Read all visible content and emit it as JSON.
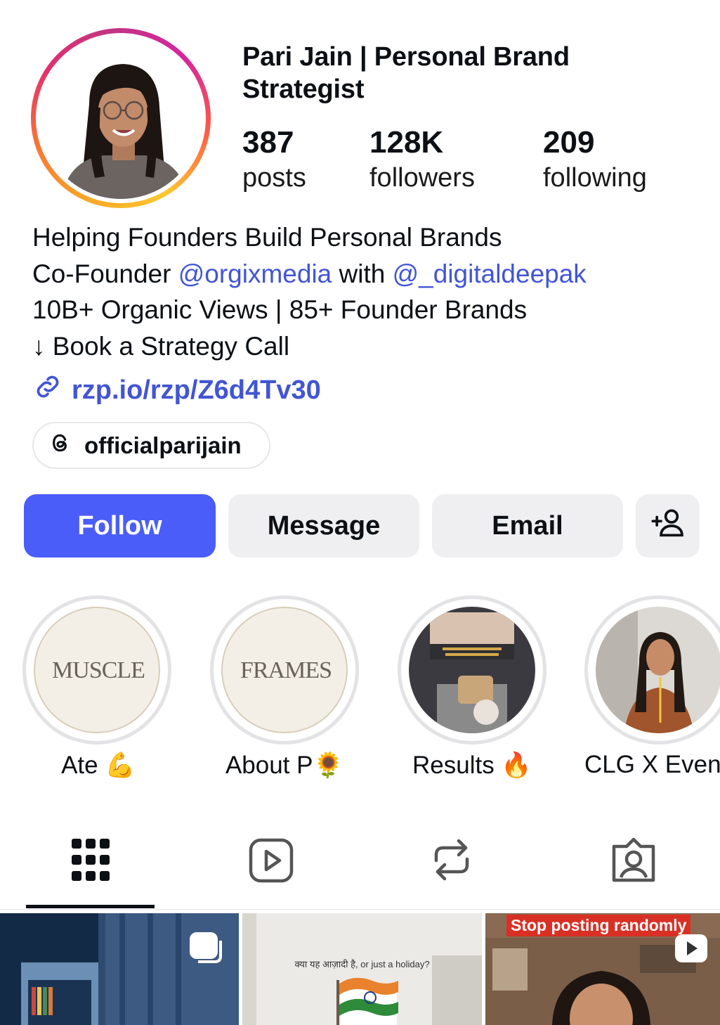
{
  "profile": {
    "name": "Pari Jain | Personal Brand Strategist",
    "stats": [
      {
        "value": "387",
        "label": "posts"
      },
      {
        "value": "128K",
        "label": "followers"
      },
      {
        "value": "209",
        "label": "following"
      }
    ],
    "bio": {
      "line1": "Helping Founders Build Personal Brands",
      "line2_prefix": "Co-Founder ",
      "mention1": "@orgixmedia",
      "line2_mid": " with ",
      "mention2": "@_digitaldeepak",
      "line3": "10B+ Organic Views | 85+ Founder Brands",
      "line4": "↓ Book a Strategy Call"
    },
    "link": "rzp.io/rzp/Z6d4Tv30",
    "threads_handle": "officialparijain"
  },
  "actions": {
    "follow": "Follow",
    "message": "Message",
    "email": "Email"
  },
  "highlights": [
    {
      "label": "Ate 💪",
      "cover_text": "MUSCLE"
    },
    {
      "label": "About P🌻",
      "cover_text": "FRAMES"
    },
    {
      "label": "Results 🔥",
      "cover_text": ""
    },
    {
      "label": "CLG X Event",
      "cover_text": ""
    }
  ],
  "posts": [
    {
      "caption": ""
    },
    {
      "caption": "क्या यह आज़ादी है, or just a holiday?"
    },
    {
      "caption": "Stop posting randomly"
    }
  ],
  "colors": {
    "accent": "#4a5df9",
    "link": "#4255d4",
    "button_gray": "#efeff2"
  },
  "icons": [
    "link-icon",
    "threads-icon",
    "add-person-icon",
    "grid-icon",
    "reels-icon",
    "reposts-icon",
    "tagged-icon",
    "multiple-posts-icon",
    "play-icon"
  ]
}
